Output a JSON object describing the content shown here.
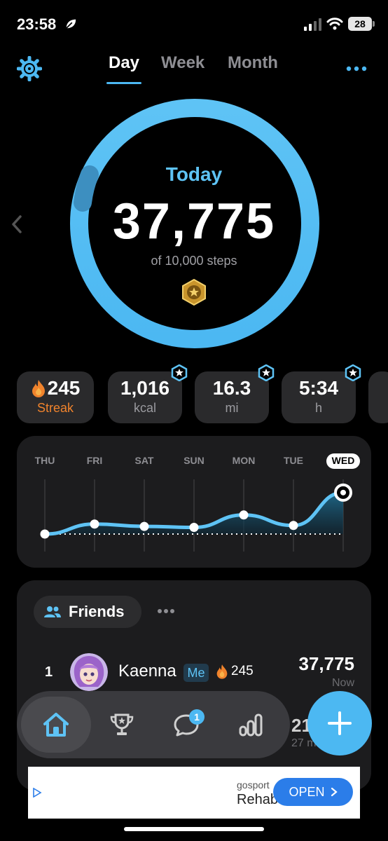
{
  "status": {
    "time": "23:58",
    "battery": "28"
  },
  "header": {
    "tabs": [
      "Day",
      "Week",
      "Month"
    ],
    "active_tab": "Day"
  },
  "progress": {
    "label": "Today",
    "steps": "37,775",
    "goal": "of 10,000 steps",
    "ring_fraction": 1.0
  },
  "stats": [
    {
      "value": "245",
      "label": "Streak"
    },
    {
      "value": "1,016",
      "label": "kcal"
    },
    {
      "value": "16.3",
      "label": "mi"
    },
    {
      "value": "5:34",
      "label": "h"
    }
  ],
  "week_chart": {
    "days": [
      "THU",
      "FRI",
      "SAT",
      "SUN",
      "MON",
      "TUE",
      "WED"
    ],
    "selected_day": "WED",
    "relative_values": [
      0.0,
      0.21,
      0.16,
      0.14,
      0.4,
      0.18,
      0.87
    ],
    "baseline": 0.0
  },
  "friends": {
    "title": "Friends",
    "entries": [
      {
        "rank": "1",
        "name": "Kaenna",
        "me_label": "Me",
        "streak": "245",
        "steps": "37,775",
        "when": "Now"
      },
      {
        "steps": "21",
        "when": "27 m"
      }
    ]
  },
  "nav": {
    "chat_badge": "1"
  },
  "ad": {
    "brand": "gosport",
    "title": "Rehab",
    "button": "OPEN"
  },
  "colors": {
    "accent": "#4cb8f2",
    "streak": "#f0832c",
    "background": "#000000"
  }
}
